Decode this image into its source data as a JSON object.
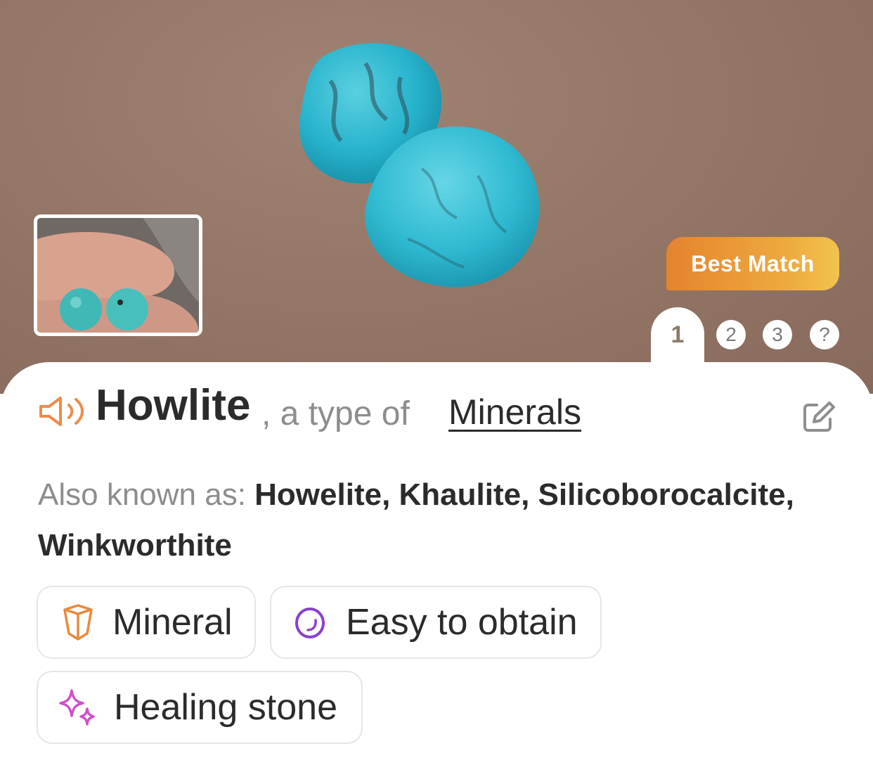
{
  "result": {
    "badge_label": "Best Match",
    "pages": [
      "1",
      "2",
      "3",
      "?"
    ],
    "active_page": "1",
    "name": "Howlite",
    "type_prefix": ", a type of ",
    "type_link": "Minerals",
    "aka_label": "Also known as: ",
    "aka_names": "Howelite, Khaulite, Silicoborocalcite, Winkworthite",
    "tags": [
      {
        "label": "Mineral",
        "icon": "crystal-icon",
        "color": "#e8893a"
      },
      {
        "label": "Easy to obtain",
        "icon": "ring-icon",
        "color": "#8b3fd0"
      },
      {
        "label": "Healing stone",
        "icon": "sparkle-icon",
        "color": "#d14fc9"
      }
    ]
  },
  "colors": {
    "badge_gradient_start": "#e5832e",
    "badge_gradient_end": "#f2c34d",
    "speaker_icon": "#ef8a4a",
    "title_text": "#2b2b2b",
    "muted_text": "#8d8d8d"
  }
}
